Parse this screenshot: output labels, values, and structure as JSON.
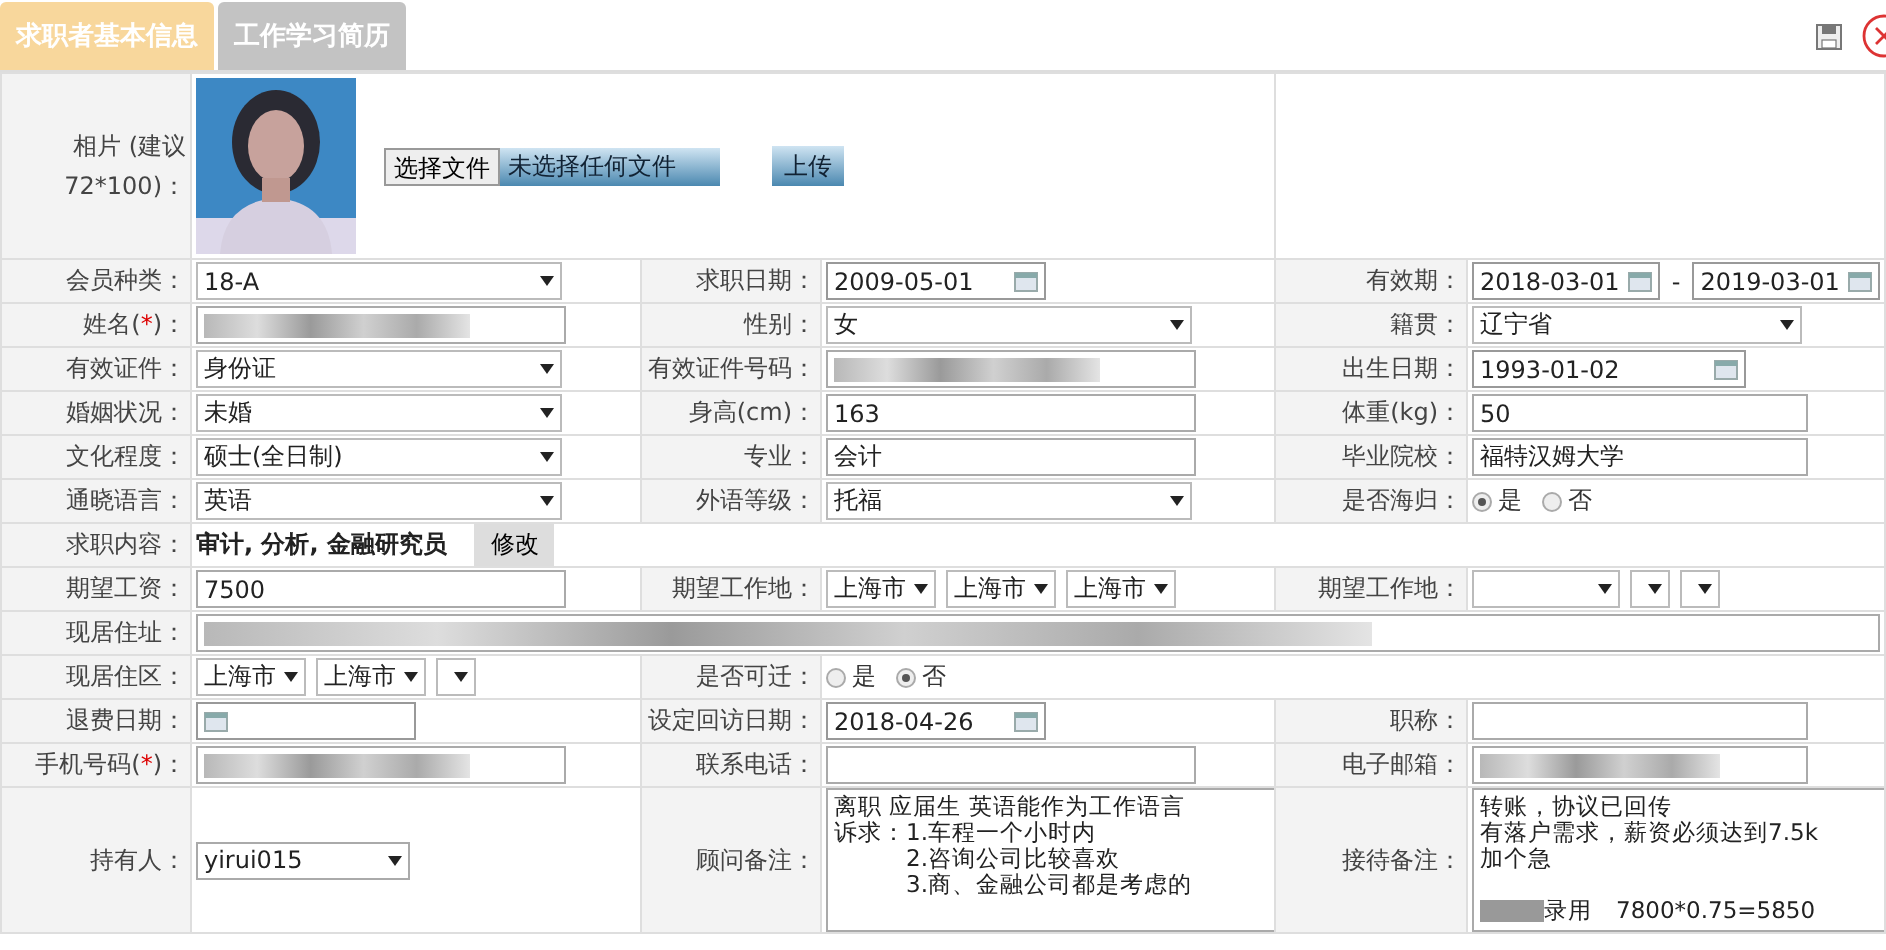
{
  "tabs": [
    {
      "label": "求职者基本信息",
      "selected": true
    },
    {
      "label": "工作学习简历",
      "selected": false
    }
  ],
  "photo_row": {
    "label_lines": [
      "相片 (建议",
      "72*100)："
    ],
    "file_button": "选择文件",
    "file_status": "未选择任何文件",
    "upload_button": "上传"
  },
  "rows": [
    {
      "cells": [
        {
          "label": "会员种类：",
          "control": {
            "kind": "select",
            "value": "18-A"
          }
        },
        {
          "label": "求职日期：",
          "control": {
            "kind": "date",
            "value": "2009-05-01"
          }
        },
        {
          "label": "有效期：",
          "control": {
            "kind": "date-range",
            "from": "2018-03-01",
            "separator": "-",
            "to": "2019-03-01"
          }
        }
      ]
    },
    {
      "cells": [
        {
          "label": "姓名(",
          "required_mark": "*",
          "label_tail": ")：",
          "control": {
            "kind": "text",
            "redacted": true
          }
        },
        {
          "label": "性别：",
          "control": {
            "kind": "select",
            "value": "女"
          }
        },
        {
          "label": "籍贯：",
          "control": {
            "kind": "select",
            "value": "辽宁省"
          }
        }
      ]
    },
    {
      "cells": [
        {
          "label": "有效证件：",
          "control": {
            "kind": "select",
            "value": "身份证"
          }
        },
        {
          "label": "有效证件号码：",
          "control": {
            "kind": "text",
            "redacted": true
          }
        },
        {
          "label": "出生日期：",
          "control": {
            "kind": "date",
            "value": "1993-01-02"
          }
        }
      ]
    },
    {
      "cells": [
        {
          "label": "婚姻状况：",
          "control": {
            "kind": "select",
            "value": "未婚"
          }
        },
        {
          "label": "身高(cm)：",
          "control": {
            "kind": "text",
            "value": "163"
          }
        },
        {
          "label": "体重(kg)：",
          "control": {
            "kind": "text",
            "value": "50"
          }
        }
      ]
    },
    {
      "cells": [
        {
          "label": "文化程度：",
          "control": {
            "kind": "select",
            "value": "硕士(全日制)"
          }
        },
        {
          "label": "专业：",
          "control": {
            "kind": "text",
            "value": "会计"
          }
        },
        {
          "label": "毕业院校：",
          "control": {
            "kind": "text",
            "value": "福特汉姆大学"
          }
        }
      ]
    },
    {
      "cells": [
        {
          "label": "通晓语言：",
          "control": {
            "kind": "select",
            "value": "英语"
          }
        },
        {
          "label": "外语等级：",
          "control": {
            "kind": "select",
            "value": "托福"
          }
        },
        {
          "label": "是否海归：",
          "control": {
            "kind": "radio",
            "options": [
              {
                "label": "是",
                "selected": true
              },
              {
                "label": "否",
                "selected": false
              }
            ]
          }
        }
      ]
    },
    {
      "cells": [
        {
          "label": "求职内容：",
          "control": {
            "kind": "text-button",
            "value": "审计, 分析, 金融研究员",
            "button": "修改"
          }
        }
      ]
    },
    {
      "cells": [
        {
          "label": "期望工资：",
          "control": {
            "kind": "text",
            "value": "7500"
          }
        },
        {
          "label": "期望工作地：",
          "control": {
            "kind": "mini-selects",
            "items": [
              {
                "kind": "city",
                "value": "上海市"
              },
              {
                "kind": "city",
                "value": "上海市"
              },
              {
                "kind": "city",
                "value": "上海市"
              }
            ]
          }
        },
        {
          "label": "期望工作地：",
          "control": {
            "kind": "mini-selects",
            "items": [
              {
                "kind": "blank"
              },
              {
                "kind": "blank"
              },
              {
                "kind": "blank"
              }
            ]
          }
        }
      ]
    },
    {
      "cells": [
        {
          "label": "现居住址：",
          "control": {
            "kind": "wide-text",
            "redacted": true
          }
        }
      ]
    },
    {
      "cells": [
        {
          "label": "现居住区：",
          "control": {
            "kind": "mini-selects",
            "items": [
              {
                "kind": "city",
                "value": "上海市"
              },
              {
                "kind": "city",
                "value": "上海市"
              },
              {
                "kind": "blank"
              }
            ]
          }
        },
        {
          "label": "是否可迁：",
          "control": {
            "kind": "radio",
            "options": [
              {
                "label": "是",
                "selected": false
              },
              {
                "label": "否",
                "selected": true
              }
            ]
          }
        }
      ]
    },
    {
      "cells": [
        {
          "label": "退费日期：",
          "control": {
            "kind": "date"
          }
        },
        {
          "label": "设定回访日期：",
          "control": {
            "kind": "date",
            "value": "2018-04-26"
          }
        },
        {
          "label": "职称：",
          "control": {
            "kind": "text"
          }
        }
      ]
    },
    {
      "cells": [
        {
          "label": "手机号码(",
          "required_mark": "*",
          "label_tail": ")：",
          "control": {
            "kind": "text",
            "redacted": true
          }
        },
        {
          "label": "联系电话：",
          "control": {
            "kind": "text"
          }
        },
        {
          "label": "电子邮箱：",
          "control": {
            "kind": "text",
            "redacted": true
          }
        }
      ]
    },
    {
      "cells": [
        {
          "label": "持有人：",
          "control": {
            "kind": "short-select",
            "value": "yirui015"
          }
        },
        {
          "label": "顾问备注：",
          "control": {
            "kind": "textarea",
            "lines": [
              {
                "text": "离职 应届生 英语能作为工作语言"
              },
              {
                "text": "诉求：1.车程一个小时内"
              },
              {
                "text": "2.咨询公司比较喜欢",
                "continuation": true
              },
              {
                "text": "3.商、金融公司都是考虑的",
                "continuation": true
              }
            ]
          }
        },
        {
          "label": "接待备注：",
          "control": {
            "kind": "textarea",
            "lines": [
              {
                "text": "转账，协议已回传"
              },
              {
                "text": "有落户需求，薪资必须达到7.5k"
              },
              {
                "text": "加个急"
              },
              {
                "text": "录用　7800*0.75=5850",
                "redacted": true,
                "gap_before": true
              }
            ]
          }
        }
      ]
    }
  ]
}
